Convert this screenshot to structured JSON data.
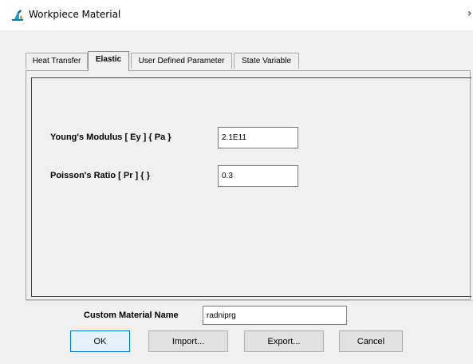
{
  "window": {
    "title": "Workpiece Material",
    "close_glyph": "›"
  },
  "tabs": [
    {
      "label": "Heat Transfer",
      "active": false
    },
    {
      "label": "Elastic",
      "active": true
    },
    {
      "label": "User Defined Parameter",
      "active": false
    },
    {
      "label": "State Variable",
      "active": false
    }
  ],
  "elastic": {
    "youngs_label": "Young's Modulus [ Ey ] { Pa }",
    "youngs_value": "2.1E11",
    "poisson_label": "Poisson's Ratio [ Pr ] {  }",
    "poisson_value": "0.3"
  },
  "footer": {
    "material_name_label": "Custom Material Name",
    "material_name_value": "radniprg",
    "ok_label": "OK",
    "import_label": "Import...",
    "export_label": "Export...",
    "cancel_label": "Cancel"
  },
  "colors": {
    "accent": "#0078d7",
    "background": "#f0f0f0"
  },
  "icons": {
    "app": "workpiece-app-icon",
    "close": "close-icon"
  }
}
